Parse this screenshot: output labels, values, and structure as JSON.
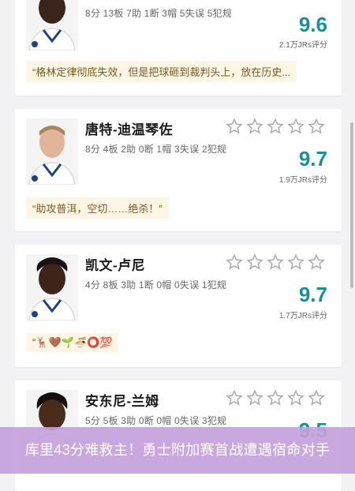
{
  "players": [
    {
      "name": "",
      "stats": "8分 13板 7助 1断 3帽 5失误 5犯规",
      "score": "9.6",
      "votes": "2.1万JRs评分",
      "quote": "“格林定律彻底失效，但是把球砸到裁判头上，放在历史..."
    },
    {
      "name": "唐特-迪温琴佐",
      "stats": "8分 4板 2助 0断 1帽 3失误 2犯规",
      "score": "9.7",
      "votes": "1.9万JRs评分",
      "quote": "“助攻普洱，空切……绝杀！”"
    },
    {
      "name": "凯文-卢尼",
      "stats": "4分 8板 3助 1断 0帽 0失误 1犯规",
      "score": "9.7",
      "votes": "1.7万JRs评分",
      "quote": "“🦌🤎🌱🍜⭕💯"
    },
    {
      "name": "安东尼-兰姆",
      "stats": "5分 5板 3助 0断 0帽 0失误 3犯规",
      "score": "9.5",
      "votes": "",
      "quote": ""
    }
  ],
  "banner": "库里43分难救主！勇士附加赛首战遭遇宿命对手",
  "colors": {
    "score": "#16909a",
    "quote_bg": "#fdf6e5",
    "banner_bg": "#c4a0dc"
  }
}
